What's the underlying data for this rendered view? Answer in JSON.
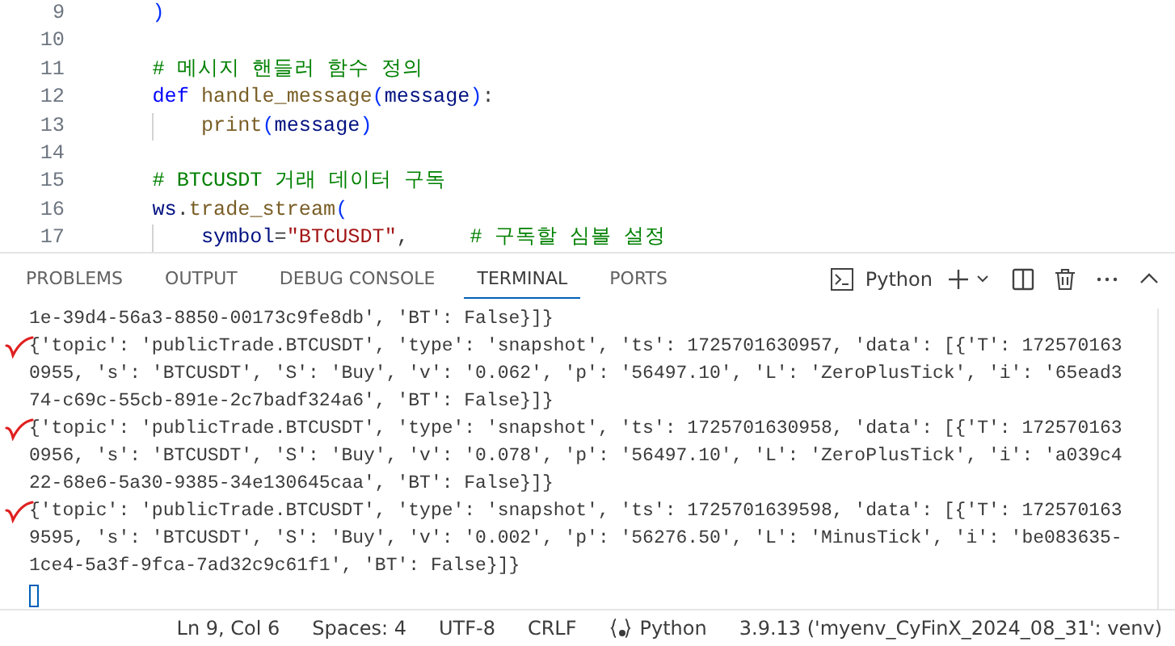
{
  "editor": {
    "lines": [
      {
        "number": "9",
        "kind": "statement",
        "tokens": [
          {
            "kind": "bracket",
            "text": ")"
          }
        ]
      },
      {
        "number": "10",
        "kind": "blank"
      },
      {
        "number": "11",
        "kind": "statement",
        "tokens": [
          {
            "kind": "comment",
            "text": "# 메시지 핸들러 함수 정의"
          }
        ]
      },
      {
        "number": "12",
        "kind": "statement",
        "tokens": [
          {
            "kind": "keyword",
            "text": "def"
          },
          {
            "kind": "function",
            "text": "handle_message"
          },
          {
            "kind": "bracket",
            "text": "("
          },
          {
            "kind": "param",
            "text": "message"
          },
          {
            "kind": "bracket",
            "text": ")"
          },
          {
            "kind": "plain",
            "text": ":"
          }
        ]
      },
      {
        "number": "13",
        "kind": "nested",
        "tokens": [
          {
            "kind": "function",
            "text": "print"
          },
          {
            "kind": "bracket",
            "text": "("
          },
          {
            "kind": "param",
            "text": "message"
          },
          {
            "kind": "bracket",
            "text": ")"
          }
        ]
      },
      {
        "number": "14",
        "kind": "blank"
      },
      {
        "number": "15",
        "kind": "statement",
        "tokens": [
          {
            "kind": "comment",
            "text": "# BTCUSDT 거래 데이터 구독"
          }
        ]
      },
      {
        "number": "16",
        "kind": "statement",
        "tokens": [
          {
            "kind": "param",
            "text": "ws"
          },
          {
            "kind": "plain",
            "text": "."
          },
          {
            "kind": "function",
            "text": "trade_stream"
          },
          {
            "kind": "bracket",
            "text": "("
          }
        ]
      },
      {
        "number": "17",
        "kind": "nested",
        "tokens": [
          {
            "kind": "param",
            "text": "symbol"
          },
          {
            "kind": "plain",
            "text": "="
          },
          {
            "kind": "string",
            "text": "\"BTCUSDT\""
          },
          {
            "kind": "plain",
            "text": ","
          },
          {
            "kind": "comment",
            "text": "# 구독할 심볼 설정"
          }
        ]
      }
    ]
  },
  "panel": {
    "tabs": [
      {
        "label": "PROBLEMS",
        "selected": false
      },
      {
        "label": "OUTPUT",
        "selected": false
      },
      {
        "label": "DEBUG CONSOLE",
        "selected": false
      },
      {
        "label": "TERMINAL",
        "selected": true
      },
      {
        "label": "PORTS",
        "selected": false
      }
    ],
    "terminal_profile": "Python",
    "terminal_lines": [
      {
        "text": "1e-39d4-56a3-8850-00173c9fe8db', 'BT': False}]}",
        "marked": false
      },
      {
        "text": "{'topic': 'publicTrade.BTCUSDT', 'type': 'snapshot', 'ts': 1725701630957, 'data': [{'T': 172570163",
        "marked": true
      },
      {
        "text": "0955, 's': 'BTCUSDT', 'S': 'Buy', 'v': '0.062', 'p': '56497.10', 'L': 'ZeroPlusTick', 'i': '65ead3",
        "marked": false
      },
      {
        "text": "74-c69c-55cb-891e-2c7badf324a6', 'BT': False}]}",
        "marked": false
      },
      {
        "text": "{'topic': 'publicTrade.BTCUSDT', 'type': 'snapshot', 'ts': 1725701630958, 'data': [{'T': 172570163",
        "marked": true
      },
      {
        "text": "0956, 's': 'BTCUSDT', 'S': 'Buy', 'v': '0.078', 'p': '56497.10', 'L': 'ZeroPlusTick', 'i': 'a039c4",
        "marked": false
      },
      {
        "text": "22-68e6-5a30-9385-34e130645caa', 'BT': False}]}",
        "marked": false
      },
      {
        "text": "{'topic': 'publicTrade.BTCUSDT', 'type': 'snapshot', 'ts': 1725701639598, 'data': [{'T': 172570163",
        "marked": true
      },
      {
        "text": "9595, 's': 'BTCUSDT', 'S': 'Buy', 'v': '0.002', 'p': '56276.50', 'L': 'MinusTick', 'i': 'be083635-",
        "marked": false
      },
      {
        "text": "1ce4-5a3f-9fca-7ad32c9c61f1', 'BT': False}]}",
        "marked": false
      }
    ]
  },
  "status_bar": {
    "position": "Ln 9, Col 6",
    "indentation": "Spaces: 4",
    "encoding": "UTF-8",
    "line_ending": "CRLF",
    "language": "Python",
    "interpreter": "3.9.13 ('myenv_CyFinX_2024_08_31': venv)"
  }
}
